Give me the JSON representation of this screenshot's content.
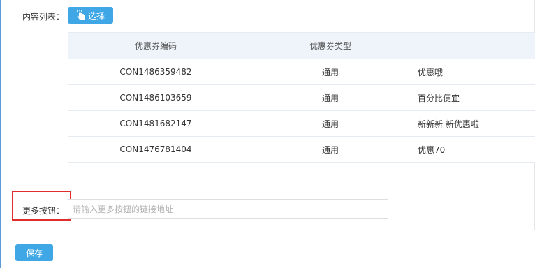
{
  "content_list": {
    "label": "内容列表：",
    "select_button": {
      "label": "选择",
      "icon": "hand-pointer-icon"
    }
  },
  "coupon_table": {
    "headers": [
      "优惠券编码",
      "优惠券类型",
      ""
    ],
    "rows": [
      [
        "CON1486359482",
        "通用",
        "优惠哦"
      ],
      [
        "CON1486103659",
        "通用",
        "百分比便宜"
      ],
      [
        "CON1481682147",
        "通用",
        "新新新 新优惠啦"
      ],
      [
        "CON1476781404",
        "通用",
        "优惠70"
      ]
    ]
  },
  "more_button": {
    "label": "更多按钮：",
    "value": "",
    "placeholder": "请输入更多按钮的链接地址"
  },
  "save_button": {
    "label": "保存"
  },
  "colors": {
    "primary": "#3fa7e6",
    "table_header_bg": "#eef4fa",
    "highlight": "#e02e2e"
  }
}
